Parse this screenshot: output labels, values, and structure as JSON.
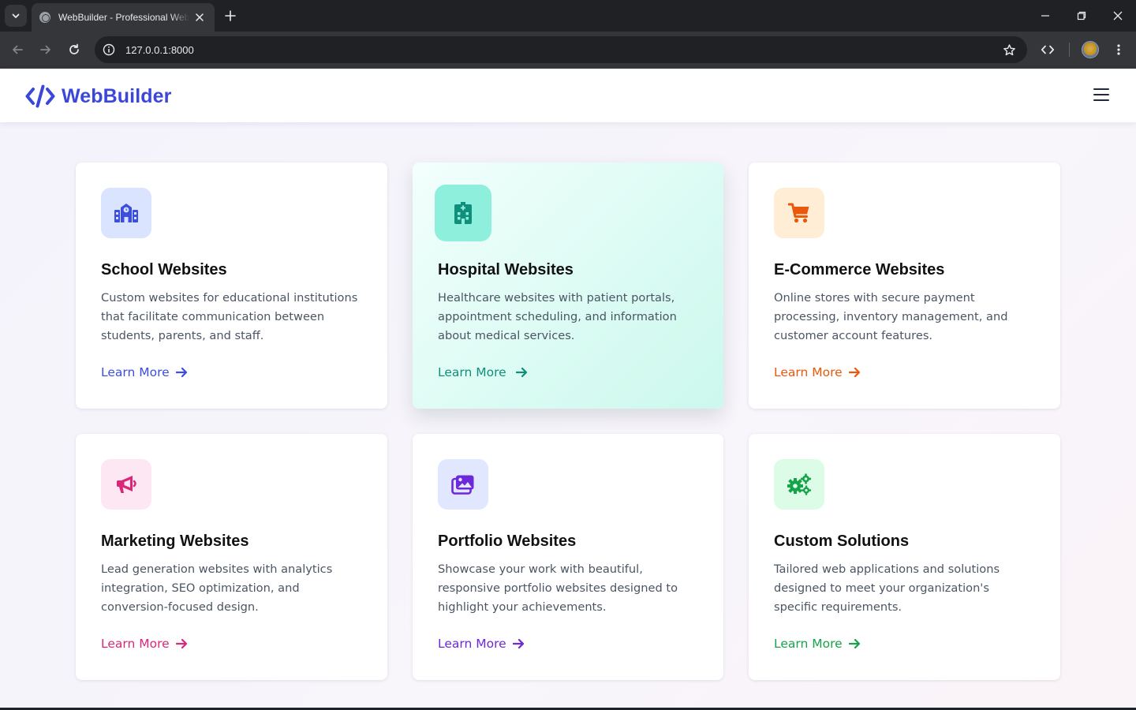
{
  "browser": {
    "tab_title": "WebBuilder - Professional Website Solutions",
    "url": "127.0.0.1:8000"
  },
  "site": {
    "brand": "WebBuilder",
    "brand_color": "#3a47d8"
  },
  "cards": [
    {
      "title": "School Websites",
      "description": "Custom websites for educational institutions that facilitate communication between students, parents, and staff.",
      "link": "Learn More",
      "icon": "school-icon",
      "accent": "#3b4ee0",
      "icon_bg": "#dbe4ff"
    },
    {
      "title": "Hospital Websites",
      "description": "Healthcare websites with patient portals, appointment scheduling, and information about medical services.",
      "link": "Learn More",
      "icon": "hospital-icon",
      "accent": "#0f8f7c",
      "icon_bg": "#8ef0dc"
    },
    {
      "title": "E-Commerce Websites",
      "description": "Online stores with secure payment processing, inventory management, and customer account features.",
      "link": "Learn More",
      "icon": "shopping-cart-icon",
      "accent": "#ea580c",
      "icon_bg": "#ffedd5"
    },
    {
      "title": "Marketing Websites",
      "description": "Lead generation websites with analytics integration, SEO optimization, and conversion-focused design.",
      "link": "Learn More",
      "icon": "megaphone-icon",
      "accent": "#db2777",
      "icon_bg": "#fce7f3"
    },
    {
      "title": "Portfolio Websites",
      "description": "Showcase your work with beautiful, responsive portfolio websites designed to highlight your achievements.",
      "link": "Learn More",
      "icon": "images-icon",
      "accent": "#6d28d9",
      "icon_bg": "#e0e7ff"
    },
    {
      "title": "Custom Solutions",
      "description": "Tailored web applications and solutions designed to meet your organization's specific requirements.",
      "link": "Learn More",
      "icon": "gears-icon",
      "accent": "#16a34a",
      "icon_bg": "#dcfce7"
    }
  ]
}
